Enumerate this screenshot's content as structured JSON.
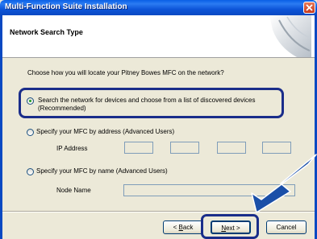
{
  "window": {
    "title": "Multi-Function Suite Installation"
  },
  "header": {
    "title": "Network Search Type"
  },
  "prompt": "Choose how you will locate your Pitney Bowes MFC on the network?",
  "options": [
    {
      "line1": "Search the network for devices and choose from a list of discovered devices",
      "line2": "(Recommended)",
      "selected": true
    },
    {
      "line1": "Specify your MFC by address (Advanced Users)",
      "selected": false
    },
    {
      "line1": "Specify your MFC by name (Advanced Users)",
      "selected": false
    }
  ],
  "ip_address": {
    "label": "IP Address",
    "octets": [
      "",
      "",
      "",
      ""
    ]
  },
  "node_name": {
    "label": "Node Name",
    "value": ""
  },
  "buttons": {
    "back": {
      "prefix": "< ",
      "hotkey": "B",
      "rest": "ack"
    },
    "next": {
      "hotkey": "N",
      "rest": "ext >"
    },
    "cancel": "Cancel"
  },
  "colors": {
    "titlebar": "#0a5fe6",
    "highlight_border": "#1a2d8a",
    "arrow": "#1a4fa8",
    "dialog_bg": "#ece9d8"
  },
  "icons": [
    "close-icon",
    "header-emblem-icon",
    "pointer-arrow-icon"
  ]
}
